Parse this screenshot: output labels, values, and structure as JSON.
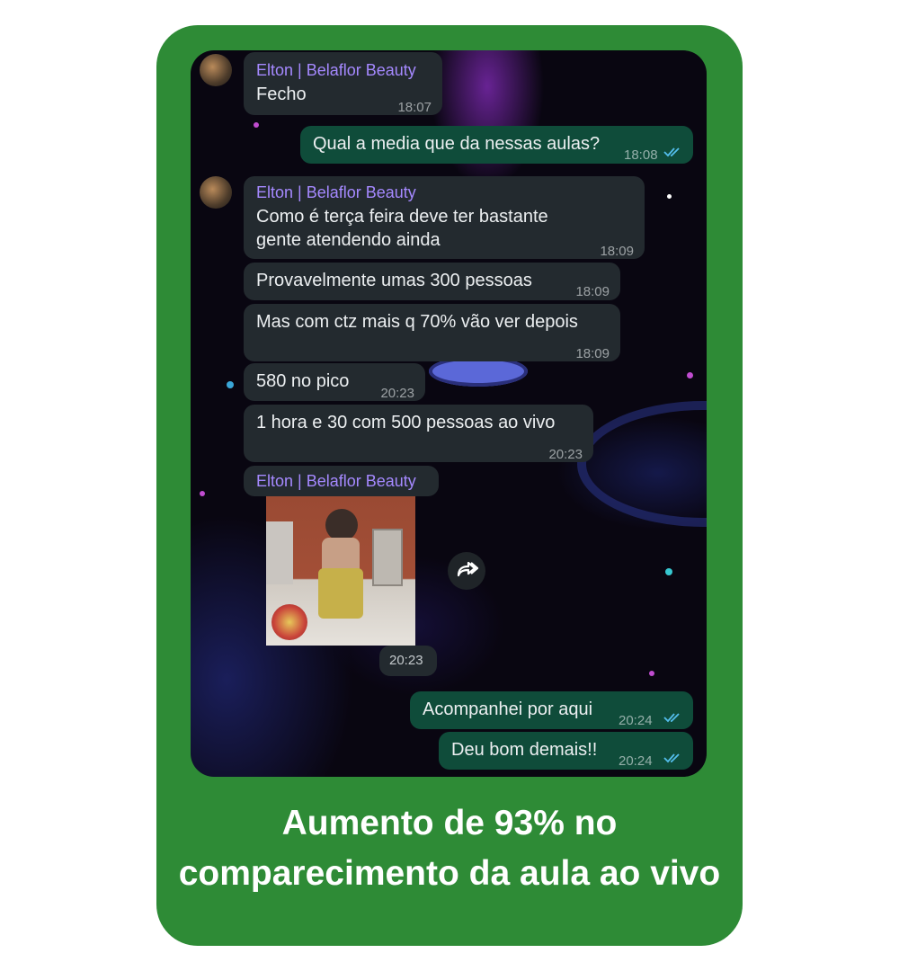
{
  "colors": {
    "card_green": "#2e8b36",
    "incoming_bubble": "#232a2f",
    "outgoing_bubble": "#0f4c3a",
    "sender_name": "#a589ff",
    "read_ticks": "#53bdeb"
  },
  "chat": {
    "messages": [
      {
        "sender": "Elton | Belaflor Beauty",
        "text": "Fecho",
        "time": "18:07"
      },
      {
        "text": "Qual a media que da nessas aulas?",
        "time": "18:08"
      },
      {
        "sender": "Elton | Belaflor Beauty",
        "text_line1": "Como é terça feira deve ter bastante",
        "text_line2": "gente atendendo ainda",
        "time": "18:09"
      },
      {
        "text": "Provavelmente umas 300 pessoas",
        "time": "18:09"
      },
      {
        "text": "Mas com ctz mais q 70% vão ver depois",
        "time": "18:09"
      },
      {
        "text": "580 no pico",
        "time": "20:23"
      },
      {
        "text": "1 hora e 30 com 500 pessoas ao vivo",
        "time": "20:23"
      },
      {
        "sender": "Elton | Belaflor Beauty",
        "time": "20:23"
      },
      {
        "text": "Acompanhei por aqui",
        "time": "20:24"
      },
      {
        "text": "Deu bom demais!!",
        "time": "20:24"
      }
    ],
    "icons": {
      "avatar": "avatar-photo",
      "ticks": "double-check-icon",
      "forward": "forward-icon",
      "media": "gif-thumbnail"
    }
  },
  "caption": {
    "line1": "Aumento de 93% no",
    "line2": "comparecimento da aula ao vivo"
  }
}
